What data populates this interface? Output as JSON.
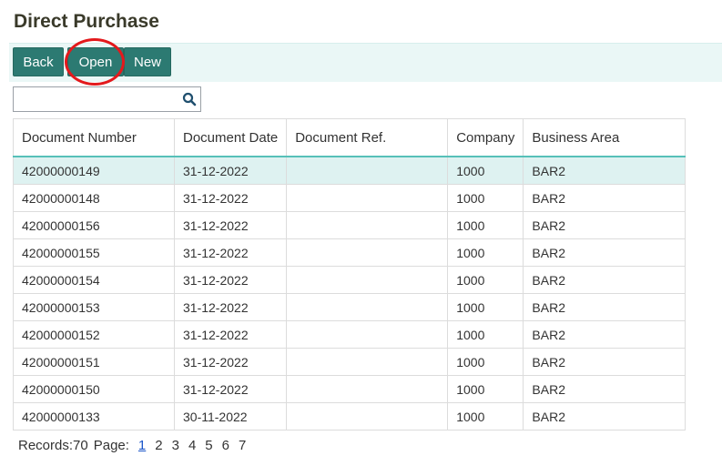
{
  "title": "Direct Purchase",
  "toolbar": {
    "back_label": "Back",
    "open_label": "Open",
    "new_label": "New"
  },
  "search": {
    "placeholder": "",
    "icon": "search-icon"
  },
  "table": {
    "columns": [
      "Document Number",
      "Document Date",
      "Document Ref.",
      "Company",
      "Business Area"
    ],
    "rows": [
      [
        "42000000149",
        "31-12-2022",
        "",
        "1000",
        "BAR2"
      ],
      [
        "42000000148",
        "31-12-2022",
        "",
        "1000",
        "BAR2"
      ],
      [
        "42000000156",
        "31-12-2022",
        "",
        "1000",
        "BAR2"
      ],
      [
        "42000000155",
        "31-12-2022",
        "",
        "1000",
        "BAR2"
      ],
      [
        "42000000154",
        "31-12-2022",
        "",
        "1000",
        "BAR2"
      ],
      [
        "42000000153",
        "31-12-2022",
        "",
        "1000",
        "BAR2"
      ],
      [
        "42000000152",
        "31-12-2022",
        "",
        "1000",
        "BAR2"
      ],
      [
        "42000000151",
        "31-12-2022",
        "",
        "1000",
        "BAR2"
      ],
      [
        "42000000150",
        "31-12-2022",
        "",
        "1000",
        "BAR2"
      ],
      [
        "42000000133",
        "30-11-2022",
        "",
        "1000",
        "BAR2"
      ]
    ],
    "selected_row": 0
  },
  "pager": {
    "records_label": "Records:70",
    "page_label": "Page:",
    "pages": [
      "1",
      "2",
      "3",
      "4",
      "5",
      "6",
      "7"
    ],
    "current_page": "1"
  },
  "colors": {
    "accent": "#2c7a72",
    "toolbar_bg": "#eaf7f6",
    "selected_row": "#def2f1",
    "highlight": "#e3191c",
    "header_border": "#56c0b8"
  }
}
